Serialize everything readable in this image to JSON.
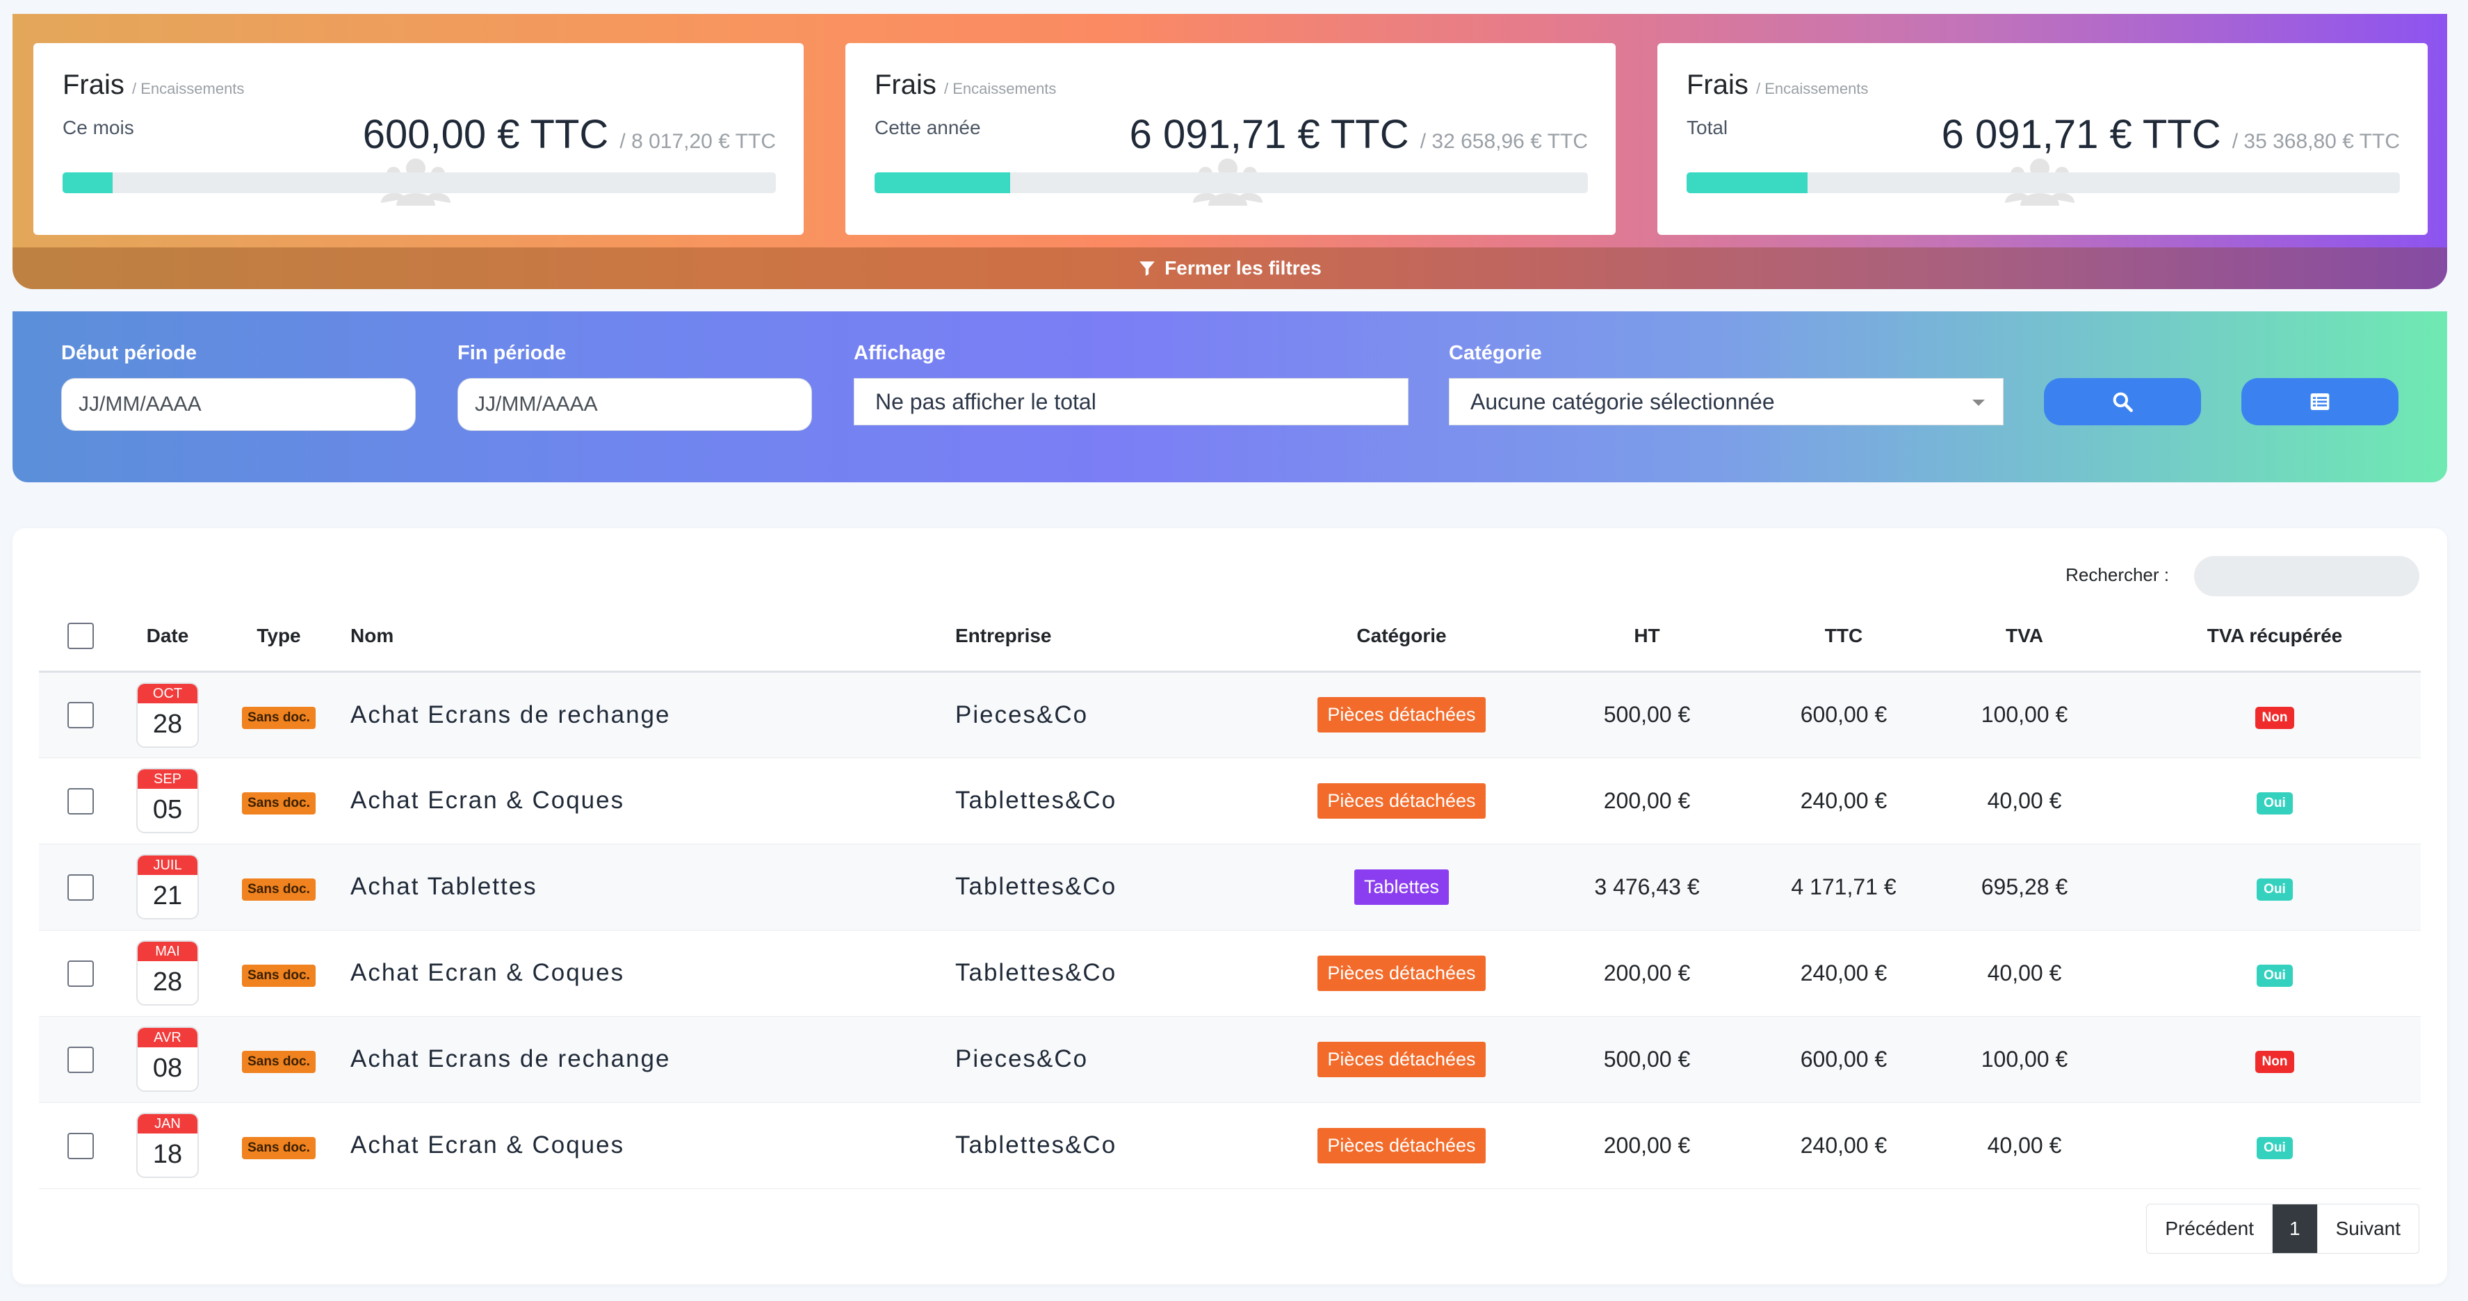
{
  "stats": [
    {
      "title": "Frais",
      "subtitle": "/ Encaissements",
      "period": "Ce mois",
      "value": "600,00 € TTC",
      "total": "/ 8 017,20 € TTC",
      "progress": 0.07,
      "fill_color": "#3ad9c2"
    },
    {
      "title": "Frais",
      "subtitle": "/ Encaissements",
      "period": "Cette année",
      "value": "6 091,71 € TTC",
      "total": "/ 32 658,96 € TTC",
      "progress": 0.19,
      "fill_color": "#3ad9c2"
    },
    {
      "title": "Frais",
      "subtitle": "/ Encaissements",
      "period": "Total",
      "value": "6 091,71 € TTC",
      "total": "/ 35 368,80 € TTC",
      "progress": 0.17,
      "fill_color": "#3ad9c2"
    }
  ],
  "filter_toggle": {
    "label": "Fermer les filtres",
    "icon": "filter-icon"
  },
  "filters": {
    "start_label": "Début période",
    "start_placeholder": "JJ/MM/AAAA",
    "end_label": "Fin période",
    "end_placeholder": "JJ/MM/AAAA",
    "display_label": "Affichage",
    "display_value": "Ne pas afficher le total",
    "category_label": "Catégorie",
    "category_value": "Aucune catégorie sélectionnée",
    "search_icon": "search-icon",
    "list_icon": "list-icon"
  },
  "table": {
    "search_label": "Rechercher :",
    "headers": {
      "date": "Date",
      "type": "Type",
      "name": "Nom",
      "company": "Entreprise",
      "category": "Catégorie",
      "ht": "HT",
      "ttc": "TTC",
      "tva": "TVA",
      "tva_recup": "TVA récupérée"
    },
    "rows": [
      {
        "month": "OCT",
        "day": "28",
        "type": "Sans doc.",
        "name": "Achat Ecrans de rechange",
        "company": "Pieces&Co",
        "category": "Pièces détachées",
        "category_color": "#f26b2a",
        "ht": "500,00 €",
        "ttc": "600,00 €",
        "tva": "100,00 €",
        "tva_recup": "Non",
        "tva_recup_color": "#ef2b2b"
      },
      {
        "month": "SEP",
        "day": "05",
        "type": "Sans doc.",
        "name": "Achat Ecran & Coques",
        "company": "Tablettes&Co",
        "category": "Pièces détachées",
        "category_color": "#f26b2a",
        "ht": "200,00 €",
        "ttc": "240,00 €",
        "tva": "40,00 €",
        "tva_recup": "Oui",
        "tva_recup_color": "#34d1bf"
      },
      {
        "month": "JUIL",
        "day": "21",
        "type": "Sans doc.",
        "name": "Achat Tablettes",
        "company": "Tablettes&Co",
        "category": "Tablettes",
        "category_color": "#8a3ef0",
        "ht": "3 476,43 €",
        "ttc": "4 171,71 €",
        "tva": "695,28 €",
        "tva_recup": "Oui",
        "tva_recup_color": "#34d1bf"
      },
      {
        "month": "MAI",
        "day": "28",
        "type": "Sans doc.",
        "name": "Achat Ecran & Coques",
        "company": "Tablettes&Co",
        "category": "Pièces détachées",
        "category_color": "#f26b2a",
        "ht": "200,00 €",
        "ttc": "240,00 €",
        "tva": "40,00 €",
        "tva_recup": "Oui",
        "tva_recup_color": "#34d1bf"
      },
      {
        "month": "AVR",
        "day": "08",
        "type": "Sans doc.",
        "name": "Achat Ecrans de rechange",
        "company": "Pieces&Co",
        "category": "Pièces détachées",
        "category_color": "#f26b2a",
        "ht": "500,00 €",
        "ttc": "600,00 €",
        "tva": "100,00 €",
        "tva_recup": "Non",
        "tva_recup_color": "#ef2b2b"
      },
      {
        "month": "JAN",
        "day": "18",
        "type": "Sans doc.",
        "name": "Achat Ecran & Coques",
        "company": "Tablettes&Co",
        "category": "Pièces détachées",
        "category_color": "#f26b2a",
        "ht": "200,00 €",
        "ttc": "240,00 €",
        "tva": "40,00 €",
        "tva_recup": "Oui",
        "tva_recup_color": "#34d1bf"
      }
    ]
  },
  "pagination": {
    "prev": "Précédent",
    "current": "1",
    "next": "Suivant"
  }
}
